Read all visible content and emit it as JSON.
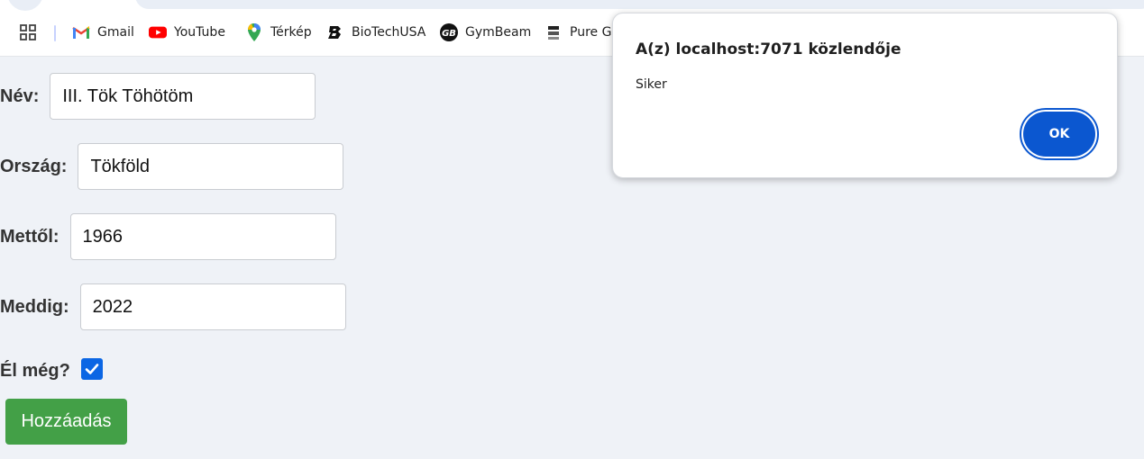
{
  "browser": {
    "bookmarks": [
      {
        "label": "",
        "icon": "apps-grid-icon"
      },
      {
        "label": "Gmail",
        "icon": "gmail-icon"
      },
      {
        "label": "YouTube",
        "icon": "youtube-icon"
      },
      {
        "label": "Térkép",
        "icon": "maps-pin-icon"
      },
      {
        "label": "BioTechUSA",
        "icon": "biotech-icon"
      },
      {
        "label": "GymBeam",
        "icon": "gymbeam-icon"
      },
      {
        "label": "Pure Go",
        "icon": "puregold-icon"
      }
    ]
  },
  "form": {
    "name_label": "Név:",
    "name_value": "III. Tök Töhötöm",
    "country_label": "Ország:",
    "country_value": "Tökföld",
    "from_label": "Mettől:",
    "from_value": "1966",
    "to_label": "Meddig:",
    "to_value": "2022",
    "alive_label": "Él még?",
    "alive_checked": true,
    "add_button": "Hozzáadás"
  },
  "dialog": {
    "title": "A(z) localhost:7071 közlendője",
    "message": "Siker",
    "ok_button": "OK"
  },
  "colors": {
    "page_bg": "#eff2f7",
    "add_button_bg": "#43a047",
    "ok_button_bg": "#0b57d0",
    "checkbox": "#0b66e4"
  }
}
